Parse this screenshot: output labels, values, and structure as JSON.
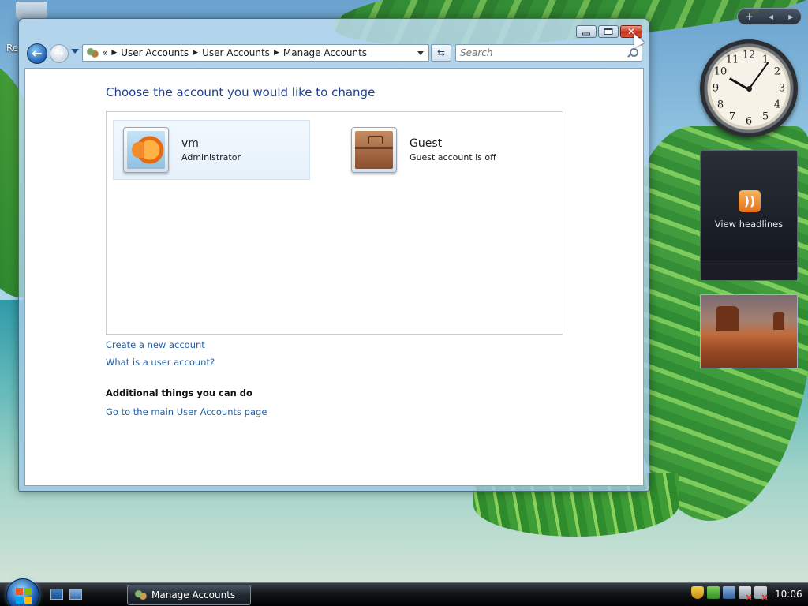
{
  "desktop": {
    "recycle_label": "Re"
  },
  "window": {
    "address": {
      "overflow": "«",
      "crumbs": [
        "User Accounts",
        "User Accounts",
        "Manage Accounts"
      ]
    },
    "search": {
      "placeholder": "Search"
    },
    "heading": "Choose the account you would like to change",
    "accounts": [
      {
        "name": "vm",
        "description": "Administrator",
        "picture": "goldfish-icon",
        "selected": true
      },
      {
        "name": "Guest",
        "description": "Guest account is off",
        "picture": "briefcase-icon",
        "selected": false
      }
    ],
    "links": {
      "create": "Create a new account",
      "what_is": "What is a user account?"
    },
    "additional": {
      "title": "Additional things you can do",
      "main_page_link": "Go to the main User Accounts page"
    }
  },
  "sidebar": {
    "controls": {
      "add": "+",
      "prev": "◂",
      "next": "▸"
    },
    "clock_numbers": [
      "12",
      "1",
      "2",
      "3",
      "4",
      "5",
      "6",
      "7",
      "8",
      "9",
      "10",
      "11"
    ],
    "feed_label": "View headlines",
    "feed_icon": "rss-icon"
  },
  "taskbar": {
    "active_task": "Manage Accounts",
    "time": "10:06"
  },
  "colors": {
    "link": "#1f5fa8",
    "heading": "#1e3f8f",
    "close_button": "#c6331d"
  }
}
